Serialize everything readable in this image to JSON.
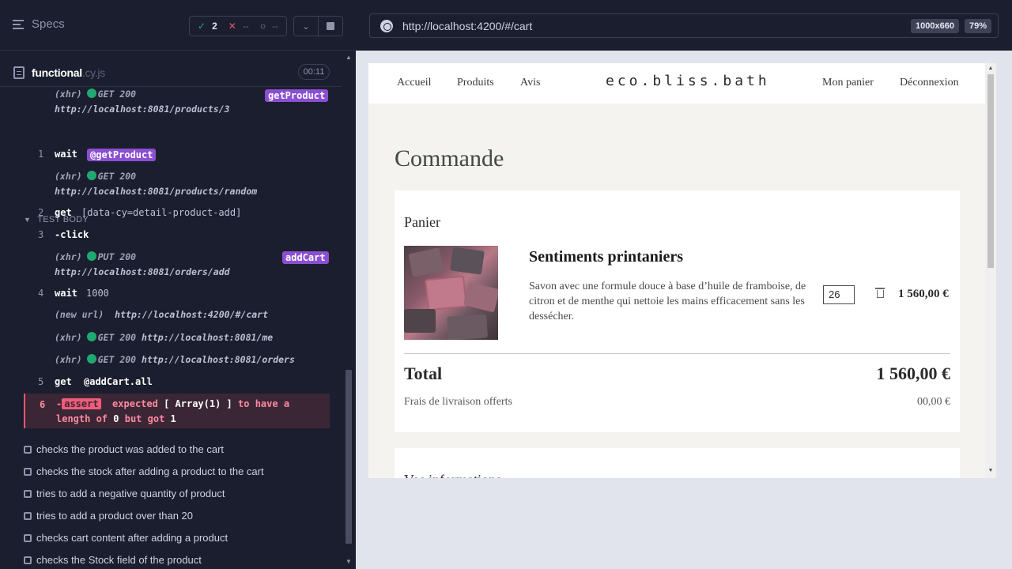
{
  "reporter": {
    "specs_label": "Specs",
    "stats": {
      "passed": "2",
      "failed": "--",
      "pending": "--"
    },
    "file": {
      "name": "functional",
      "ext": ".cy.js",
      "duration": "00:11"
    },
    "top_xhr": {
      "text": "(xhr)",
      "method": "GET 200",
      "url": "http://localhost:8081/products/3",
      "alias": "getProduct"
    },
    "test_body_label": "TEST BODY",
    "commands": [
      {
        "num": "1",
        "name": "wait",
        "alias": "@getProduct"
      },
      {
        "xhr": "(xhr)",
        "method": "GET 200",
        "url": "http://localhost:8081/products/random"
      },
      {
        "num": "2",
        "name": "get",
        "msg": "[data-cy=detail-product-add]"
      },
      {
        "num": "3",
        "name": "-click"
      },
      {
        "xhr": "(xhr)",
        "method": "PUT 200",
        "url": "http://localhost:8081/orders/add",
        "alias": "addCart"
      },
      {
        "num": "4",
        "name": "wait",
        "msg": "1000"
      },
      {
        "xhr": "(new url)",
        "url": "http://localhost:4200/#/cart"
      },
      {
        "xhr": "(xhr)",
        "method": "GET 200",
        "url": "http://localhost:8081/me"
      },
      {
        "xhr": "(xhr)",
        "method": "GET 200",
        "url": "http://localhost:8081/orders"
      },
      {
        "num": "5",
        "name": "get",
        "msg": "@addCart.all"
      }
    ],
    "error": {
      "num": "6",
      "prefix": "-",
      "tag": "assert",
      "part1": "expected",
      "subject": "[ Array(1) ]",
      "part2": "to have a length of",
      "expected_len": "0",
      "part3": "but got",
      "actual_len": "1"
    },
    "tests": [
      "checks the product was added to the cart",
      "checks the stock after adding a product to the cart",
      "tries to add a negative quantity of product",
      "tries to add a product over than 20",
      "checks cart content after adding a product",
      "checks the Stock field of the product"
    ]
  },
  "preview": {
    "url": "http://localhost:4200/#/cart",
    "viewport": "1000x660",
    "zoom": "79%"
  },
  "site": {
    "nav": {
      "home": "Accueil",
      "products": "Produits",
      "reviews": "Avis",
      "logo": "eco.bliss.bath",
      "cart": "Mon panier",
      "logout": "Déconnexion"
    },
    "page_title": "Commande",
    "cart_title": "Panier",
    "product": {
      "name": "Sentiments printaniers",
      "description": "Savon avec une formule douce à base d’huile de framboise, de citron et de menthe qui nettoie les mains efficacement sans les dessécher.",
      "quantity": "26",
      "price": "1 560,00 €"
    },
    "total_label": "Total",
    "total_value": "1 560,00 €",
    "shipping_label": "Frais de livraison offerts",
    "shipping_value": "00,00 €",
    "next_section": "Vos informations"
  },
  "colors": {
    "pass": "#1fa971",
    "fail": "#e45770",
    "alias": "#8b4fd1",
    "accent": "#3f4a47"
  },
  "icons": [
    "menu-icon",
    "file-icon",
    "chevron-down-icon",
    "stop-icon",
    "globe-icon",
    "trash-icon",
    "check-icon",
    "x-icon",
    "spinner-icon"
  ]
}
